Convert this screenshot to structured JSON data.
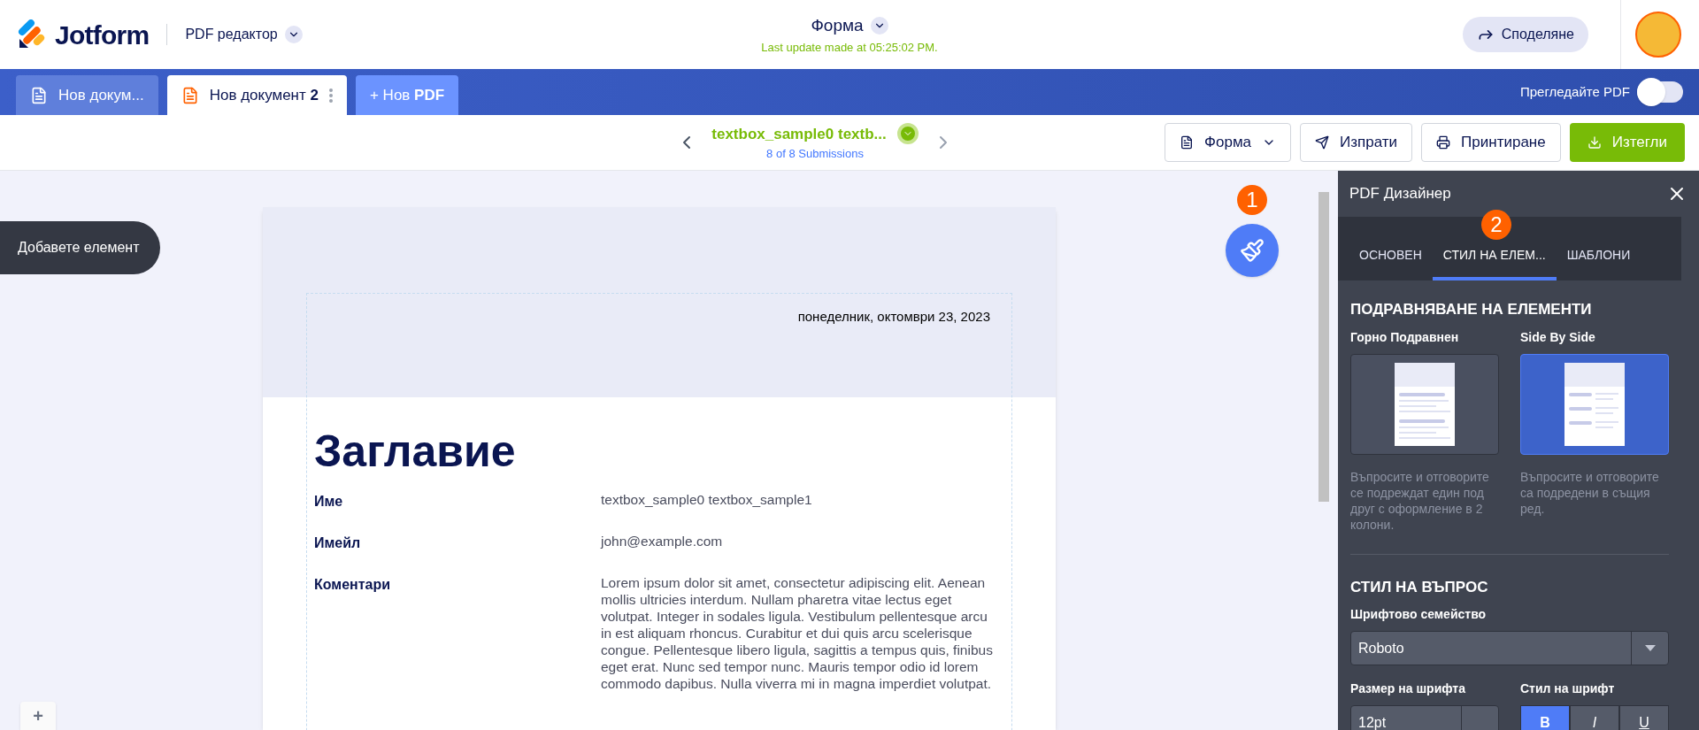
{
  "header": {
    "logo": "Jotform",
    "product": "PDF редактор",
    "title": "Форма",
    "last_update": "Last update made at 05:25:02 PM.",
    "share": "Споделяне"
  },
  "doc_tabs": [
    {
      "label": "Нов докум...",
      "selected": false
    },
    {
      "label": "Нов документ **2**",
      "selected": true
    }
  ],
  "new_pdf": "+ Нов **PDF**",
  "preview": {
    "label": "Прегледайте PDF",
    "on": false
  },
  "submission": {
    "title": "textbox_sample0 textb...",
    "count": "8 of 8 Submissions"
  },
  "toolbar": [
    {
      "kind": "dropdown",
      "label": "Форма"
    },
    {
      "kind": "send",
      "label": "Изпрати"
    },
    {
      "kind": "print",
      "label": "Принтиране"
    },
    {
      "kind": "download",
      "label": "Изтегли"
    }
  ],
  "add_element": "Добавете елемент",
  "tour_badges": [
    "1",
    "2"
  ],
  "zoom_in": "+",
  "document": {
    "date": "понеделник, октомври 23, 2023",
    "heading": "Заглавие",
    "fields": [
      {
        "label": "Име",
        "value": "textbox_sample0 textbox_sample1"
      },
      {
        "label": "Имейл",
        "value": "john@example.com"
      },
      {
        "label": "Коментари",
        "value": "Lorem ipsum dolor sit amet, consectetur adipiscing elit. Aenean mollis ultricies interdum. Nullam pharetra vitae lectus eget volutpat. Integer in sodales ligula. Vestibulum pellentesque arcu in est aliquam rhoncus. Curabitur et dui quis arcu scelerisque congue. Pellentesque libero ligula, sagittis a tempus quis, finibus eget erat. Nunc sed tempor nunc. Mauris tempor odio id lorem commodo dapibus. Nulla viverra mi in magna imperdiet volutpat."
      }
    ]
  },
  "panel": {
    "title": "PDF Дизайнер",
    "tabs": [
      {
        "label": "ОСНОВЕН",
        "selected": false
      },
      {
        "label": "СТИЛ НА ЕЛЕМ...",
        "selected": true
      },
      {
        "label": "ШАБЛОНИ",
        "selected": false
      }
    ],
    "alignment": {
      "title": "ПОДРАВНЯВАНЕ НА ЕЛЕМЕНТИ",
      "options": [
        {
          "kind": "stacked",
          "label": "Горно Подравнен",
          "description": "Въпросите и отговорите се подреждат един под друг с оформление в 2 колони.",
          "selected": false
        },
        {
          "kind": "side",
          "label": "Side By Side",
          "description": "Въпросите и отговорите са подредени в същия ред.",
          "selected": true
        }
      ]
    },
    "question_style": {
      "title": "СТИЛ НА ВЪПРОС",
      "font_family_label": "Шрифтово семейство",
      "font_family": "Roboto",
      "font_size_label": "Размер на шрифта",
      "font_size": "12pt",
      "font_style_label": "Стил на шрифт",
      "styles": [
        {
          "label": "B",
          "selected": true
        },
        {
          "label": "I",
          "selected": false
        },
        {
          "label": "U",
          "selected": false
        }
      ]
    }
  }
}
